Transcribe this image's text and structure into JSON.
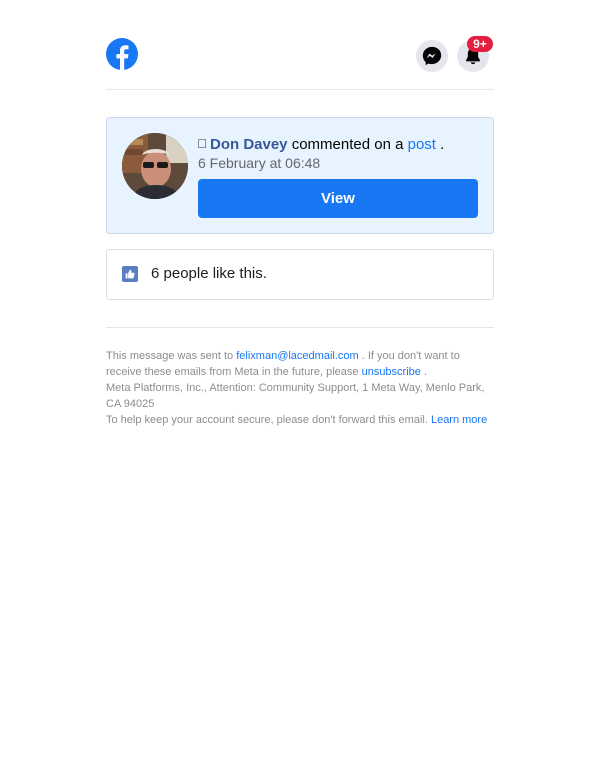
{
  "header": {
    "logo": "facebook-logo-icon",
    "messenger_icon": "messenger-icon",
    "bell_icon": "bell-icon",
    "notification_badge": "9+"
  },
  "notification": {
    "actor": "Don Davey",
    "action": "commented on a",
    "object_link": "post",
    "trailing": ".",
    "timestamp": "6 February at 06:48",
    "view_label": "View"
  },
  "likes": {
    "text": "6 people like this."
  },
  "footer": {
    "sent_to_prefix": "This message was sent to",
    "email": "felixman@lacedmail.com",
    "unsubscribe_prefix": ". If you don't want to receive these emails from Meta in the future, please",
    "unsubscribe_label": "unsubscribe",
    "unsubscribe_suffix": ".",
    "address": "Meta Platforms, Inc., Attention: Community Support, 1 Meta Way, Menlo Park, CA 94025",
    "security_note": "To help keep your account secure, please don't forward this email.",
    "learn_more": "Learn more"
  },
  "colors": {
    "brand_blue": "#1877f2",
    "badge_red": "#e41e3f",
    "card_bg": "#e7f3ff"
  }
}
